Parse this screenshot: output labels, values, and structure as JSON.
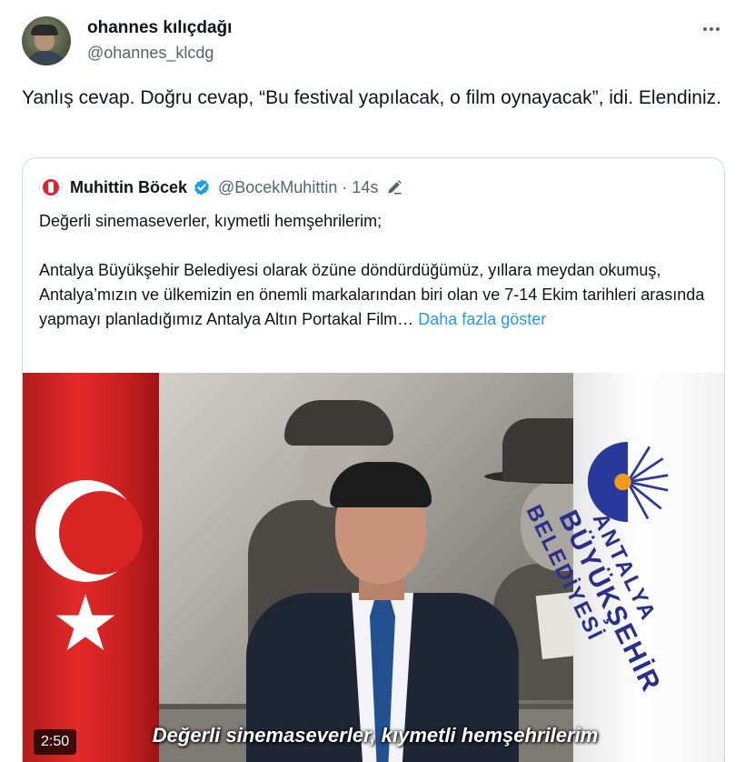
{
  "author": {
    "display_name": "ohannes kılıçdağı",
    "handle": "@ohannes_klcdg"
  },
  "tweet": {
    "text": "Yanlış cevap. Doğru cevap, “Bu festival yapılacak, o film oynayacak”, idi. Elendiniz."
  },
  "quoted_tweet": {
    "display_name": "Muhittin Böcek",
    "handle": "@BocekMuhittin",
    "separator": "·",
    "time": "14s",
    "paragraph_1": "Değerli sinemaseverler, kıymetli hemşehrilerim;",
    "paragraph_2": "Antalya Büyükşehir Belediyesi olarak özüne döndürdüğümüz, yıllara meydan okumuş, Antalya’mızın ve ülkemizin en önemli markalarından biri olan ve 7-14 Ekim tarihleri arasında yapmayı planladığımız Antalya Altın Portakal Film…",
    "show_more": "Daha fazla göster",
    "video": {
      "duration": "2:50",
      "caption": "Değerli sinemaseverler, kıymetli hemşehrilerim",
      "banner_line_1": "ANTALYA",
      "banner_line_2": "BÜYÜKŞEHİR",
      "banner_line_3": "BELEDİYESİ"
    }
  },
  "icons": {
    "more": "more-dots-icon",
    "verified": "verified-badge-icon",
    "edit": "edit-pencil-icon"
  },
  "colors": {
    "link": "#1d9bf0",
    "verified": "#1d9bf0",
    "secondary_text": "#536471",
    "border": "#cfd9de"
  }
}
